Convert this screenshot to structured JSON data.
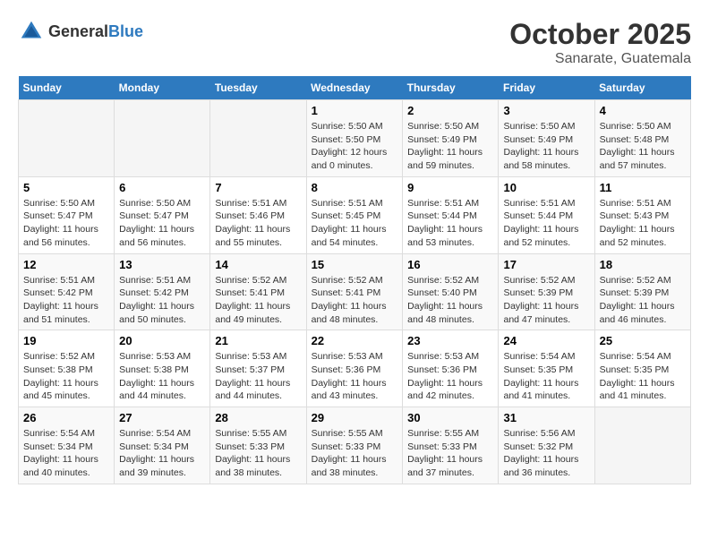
{
  "logo": {
    "general": "General",
    "blue": "Blue"
  },
  "title": "October 2025",
  "subtitle": "Sanarate, Guatemala",
  "days_of_week": [
    "Sunday",
    "Monday",
    "Tuesday",
    "Wednesday",
    "Thursday",
    "Friday",
    "Saturday"
  ],
  "weeks": [
    [
      {
        "day": "",
        "info": ""
      },
      {
        "day": "",
        "info": ""
      },
      {
        "day": "",
        "info": ""
      },
      {
        "day": "1",
        "info": "Sunrise: 5:50 AM\nSunset: 5:50 PM\nDaylight: 12 hours and 0 minutes."
      },
      {
        "day": "2",
        "info": "Sunrise: 5:50 AM\nSunset: 5:49 PM\nDaylight: 11 hours and 59 minutes."
      },
      {
        "day": "3",
        "info": "Sunrise: 5:50 AM\nSunset: 5:49 PM\nDaylight: 11 hours and 58 minutes."
      },
      {
        "day": "4",
        "info": "Sunrise: 5:50 AM\nSunset: 5:48 PM\nDaylight: 11 hours and 57 minutes."
      }
    ],
    [
      {
        "day": "5",
        "info": "Sunrise: 5:50 AM\nSunset: 5:47 PM\nDaylight: 11 hours and 56 minutes."
      },
      {
        "day": "6",
        "info": "Sunrise: 5:50 AM\nSunset: 5:47 PM\nDaylight: 11 hours and 56 minutes."
      },
      {
        "day": "7",
        "info": "Sunrise: 5:51 AM\nSunset: 5:46 PM\nDaylight: 11 hours and 55 minutes."
      },
      {
        "day": "8",
        "info": "Sunrise: 5:51 AM\nSunset: 5:45 PM\nDaylight: 11 hours and 54 minutes."
      },
      {
        "day": "9",
        "info": "Sunrise: 5:51 AM\nSunset: 5:44 PM\nDaylight: 11 hours and 53 minutes."
      },
      {
        "day": "10",
        "info": "Sunrise: 5:51 AM\nSunset: 5:44 PM\nDaylight: 11 hours and 52 minutes."
      },
      {
        "day": "11",
        "info": "Sunrise: 5:51 AM\nSunset: 5:43 PM\nDaylight: 11 hours and 52 minutes."
      }
    ],
    [
      {
        "day": "12",
        "info": "Sunrise: 5:51 AM\nSunset: 5:42 PM\nDaylight: 11 hours and 51 minutes."
      },
      {
        "day": "13",
        "info": "Sunrise: 5:51 AM\nSunset: 5:42 PM\nDaylight: 11 hours and 50 minutes."
      },
      {
        "day": "14",
        "info": "Sunrise: 5:52 AM\nSunset: 5:41 PM\nDaylight: 11 hours and 49 minutes."
      },
      {
        "day": "15",
        "info": "Sunrise: 5:52 AM\nSunset: 5:41 PM\nDaylight: 11 hours and 48 minutes."
      },
      {
        "day": "16",
        "info": "Sunrise: 5:52 AM\nSunset: 5:40 PM\nDaylight: 11 hours and 48 minutes."
      },
      {
        "day": "17",
        "info": "Sunrise: 5:52 AM\nSunset: 5:39 PM\nDaylight: 11 hours and 47 minutes."
      },
      {
        "day": "18",
        "info": "Sunrise: 5:52 AM\nSunset: 5:39 PM\nDaylight: 11 hours and 46 minutes."
      }
    ],
    [
      {
        "day": "19",
        "info": "Sunrise: 5:52 AM\nSunset: 5:38 PM\nDaylight: 11 hours and 45 minutes."
      },
      {
        "day": "20",
        "info": "Sunrise: 5:53 AM\nSunset: 5:38 PM\nDaylight: 11 hours and 44 minutes."
      },
      {
        "day": "21",
        "info": "Sunrise: 5:53 AM\nSunset: 5:37 PM\nDaylight: 11 hours and 44 minutes."
      },
      {
        "day": "22",
        "info": "Sunrise: 5:53 AM\nSunset: 5:36 PM\nDaylight: 11 hours and 43 minutes."
      },
      {
        "day": "23",
        "info": "Sunrise: 5:53 AM\nSunset: 5:36 PM\nDaylight: 11 hours and 42 minutes."
      },
      {
        "day": "24",
        "info": "Sunrise: 5:54 AM\nSunset: 5:35 PM\nDaylight: 11 hours and 41 minutes."
      },
      {
        "day": "25",
        "info": "Sunrise: 5:54 AM\nSunset: 5:35 PM\nDaylight: 11 hours and 41 minutes."
      }
    ],
    [
      {
        "day": "26",
        "info": "Sunrise: 5:54 AM\nSunset: 5:34 PM\nDaylight: 11 hours and 40 minutes."
      },
      {
        "day": "27",
        "info": "Sunrise: 5:54 AM\nSunset: 5:34 PM\nDaylight: 11 hours and 39 minutes."
      },
      {
        "day": "28",
        "info": "Sunrise: 5:55 AM\nSunset: 5:33 PM\nDaylight: 11 hours and 38 minutes."
      },
      {
        "day": "29",
        "info": "Sunrise: 5:55 AM\nSunset: 5:33 PM\nDaylight: 11 hours and 38 minutes."
      },
      {
        "day": "30",
        "info": "Sunrise: 5:55 AM\nSunset: 5:33 PM\nDaylight: 11 hours and 37 minutes."
      },
      {
        "day": "31",
        "info": "Sunrise: 5:56 AM\nSunset: 5:32 PM\nDaylight: 11 hours and 36 minutes."
      },
      {
        "day": "",
        "info": ""
      }
    ]
  ]
}
